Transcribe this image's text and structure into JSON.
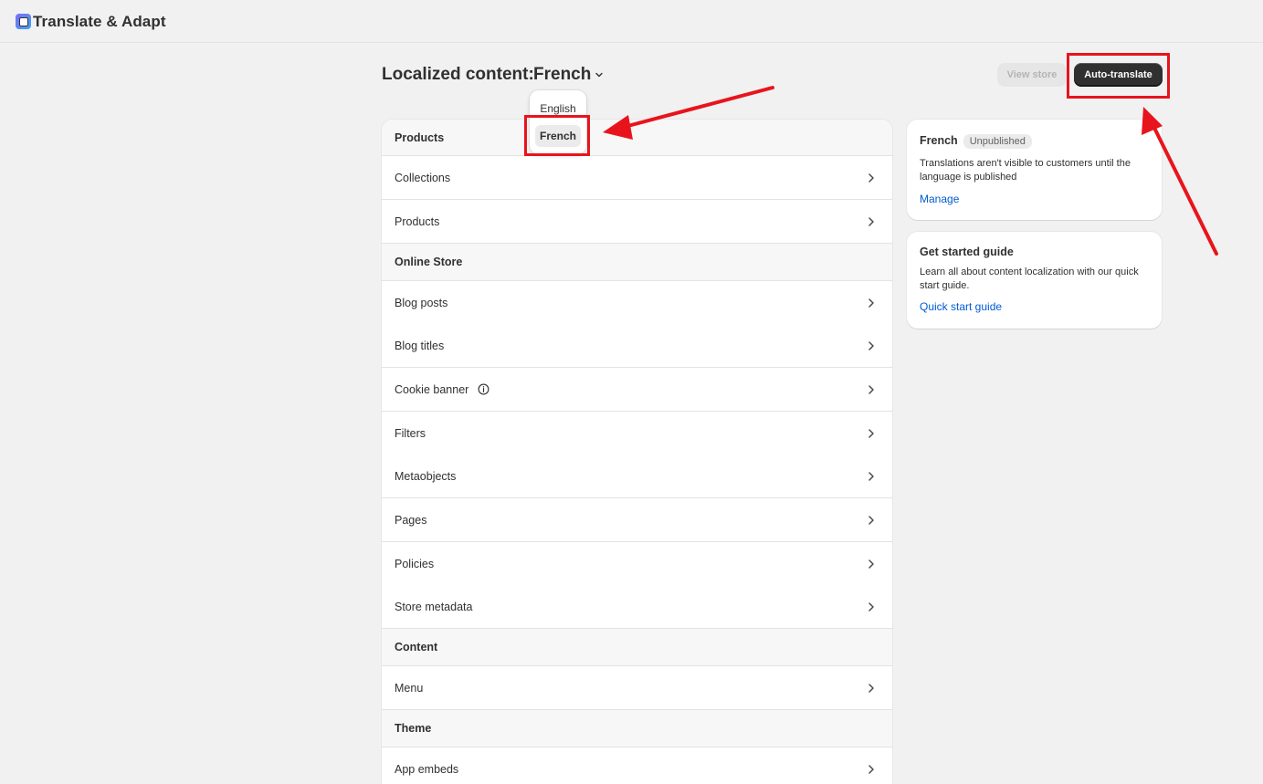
{
  "app": {
    "title": "Translate & Adapt",
    "logo_icon": "translate-adapt-logo-icon"
  },
  "header": {
    "heading": "Localized content:",
    "selected_language": "French",
    "view_store_label": "View store",
    "auto_translate_label": "Auto-translate"
  },
  "dropdown": {
    "options": [
      "English",
      "French"
    ],
    "selected": "French"
  },
  "list": {
    "sections": [
      {
        "title": "Products",
        "items": [
          "Collections",
          "Products"
        ]
      },
      {
        "title": "Online Store",
        "items": [
          "Blog posts",
          "Blog titles",
          "Cookie banner",
          "Filters",
          "Metaobjects",
          "Pages",
          "Policies",
          "Store metadata"
        ]
      },
      {
        "title": "Content",
        "items": [
          "Menu"
        ]
      },
      {
        "title": "Theme",
        "items": [
          "App embeds"
        ]
      }
    ]
  },
  "status_card": {
    "language": "French",
    "badge": "Unpublished",
    "body": "Translations aren't visible to customers until the language is published",
    "link": "Manage"
  },
  "guide_card": {
    "title": "Get started guide",
    "body": "Learn all about content localization with our quick start guide.",
    "link": "Quick start guide"
  },
  "colors": {
    "background": "#f1f1f1",
    "primary_button": "#303030",
    "link": "#005bd3",
    "annotation": "#e8141c"
  }
}
